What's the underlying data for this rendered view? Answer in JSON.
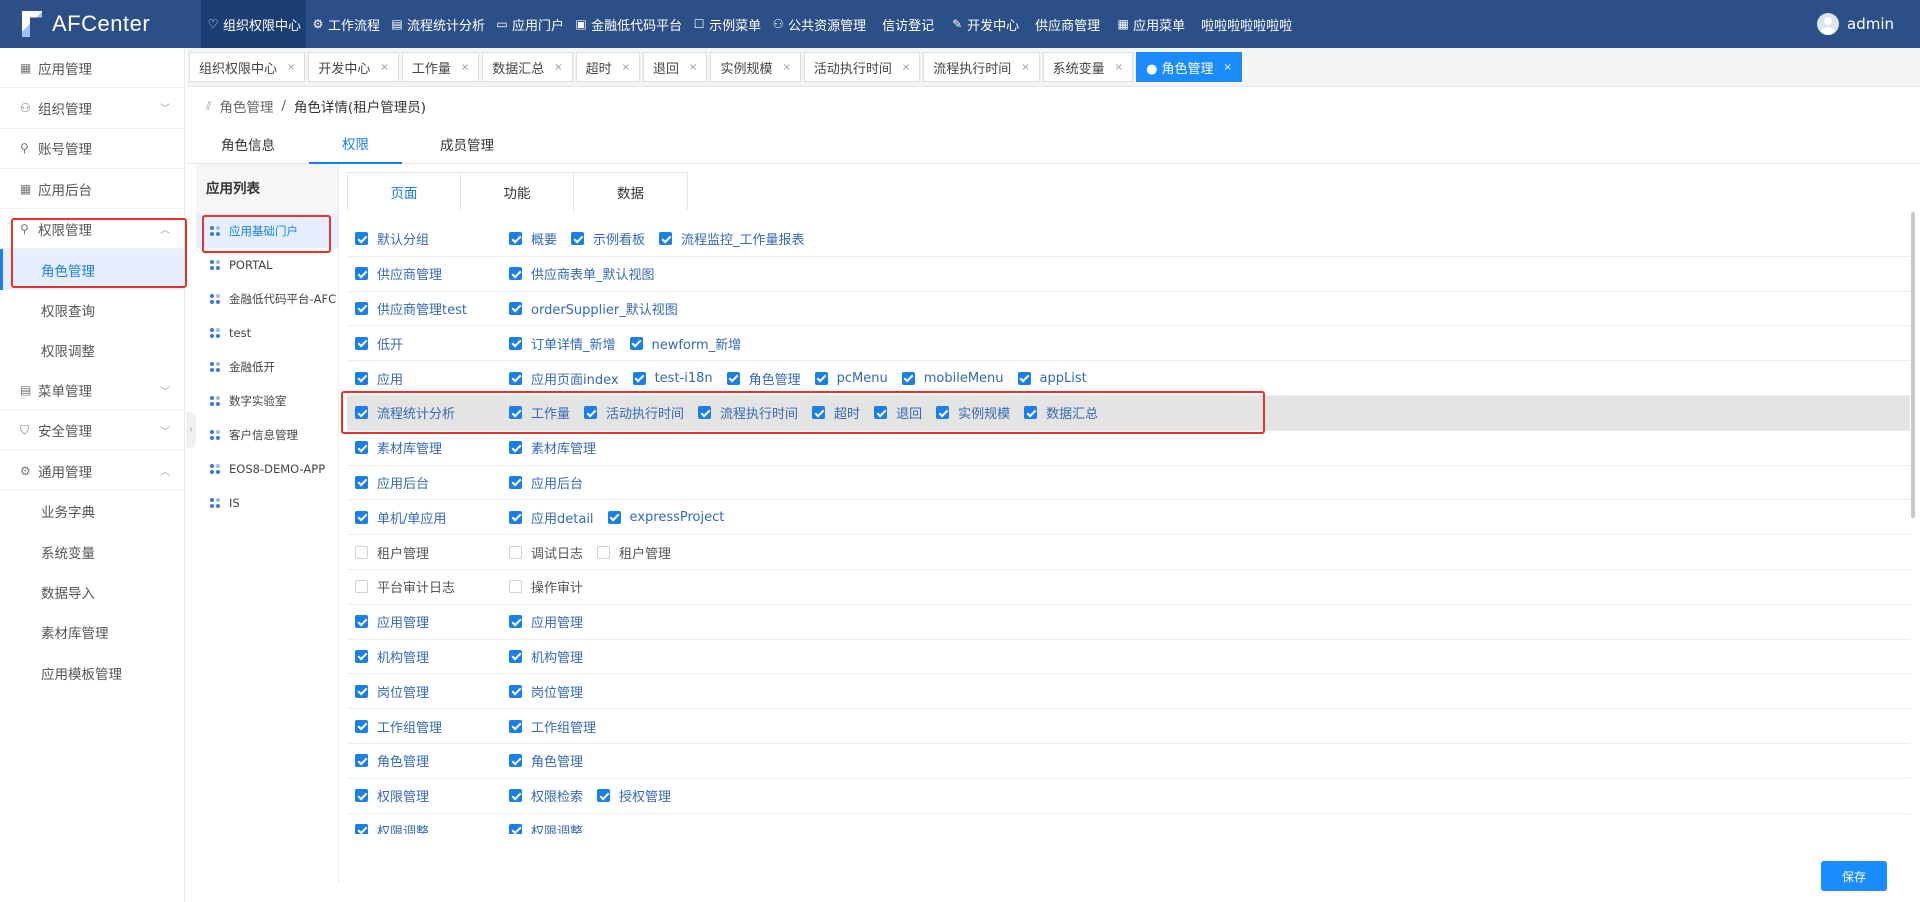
{
  "app": {
    "name": "AFCenter",
    "user": "admin"
  },
  "topnav": [
    {
      "label": "组织权限中心",
      "icon": "shield-icon",
      "glyph": "♡",
      "active": true
    },
    {
      "label": "工作流程",
      "icon": "flow-icon",
      "glyph": "⚙"
    },
    {
      "label": "流程统计分析",
      "icon": "chart-icon",
      "glyph": "▤"
    },
    {
      "label": "应用门户",
      "icon": "portal-icon",
      "glyph": "▭"
    },
    {
      "label": "金融低代码平台",
      "icon": "code-icon",
      "glyph": "▣"
    },
    {
      "label": "示例菜单",
      "icon": "menu-icon",
      "glyph": "☐"
    },
    {
      "label": "公共资源管理",
      "icon": "resource-icon",
      "glyph": "⚇"
    },
    {
      "label": "信访登记",
      "icon": "",
      "glyph": ""
    },
    {
      "label": "开发中心",
      "icon": "edit-icon",
      "glyph": "✎"
    },
    {
      "label": "供应商管理",
      "icon": "",
      "glyph": ""
    },
    {
      "label": "应用菜单",
      "icon": "apps-icon",
      "glyph": "▦"
    },
    {
      "label": "啦啦啦啦啦啦啦",
      "icon": "",
      "glyph": ""
    }
  ],
  "sidebar": [
    {
      "label": "应用管理",
      "icon": "apps-icon",
      "glyph": "▦"
    },
    {
      "label": "组织管理",
      "icon": "org-icon",
      "glyph": "⚇",
      "arrow": "﹀"
    },
    {
      "label": "账号管理",
      "icon": "user-icon",
      "glyph": "⚲"
    },
    {
      "label": "应用后台",
      "icon": "grid-icon",
      "glyph": "▦"
    },
    {
      "label": "权限管理",
      "icon": "permission-icon",
      "glyph": "⚲",
      "arrow": "︿"
    },
    {
      "label": "角色管理",
      "sub": true,
      "selected": true
    },
    {
      "label": "权限查询",
      "sub": true
    },
    {
      "label": "权限调整",
      "sub": true
    },
    {
      "label": "菜单管理",
      "icon": "menu-icon",
      "glyph": "▤",
      "arrow": "﹀"
    },
    {
      "label": "安全管理",
      "icon": "shield-icon",
      "glyph": "⛉",
      "arrow": "﹀"
    },
    {
      "label": "通用管理",
      "icon": "settings-icon",
      "glyph": "⚙",
      "arrow": "︿"
    },
    {
      "label": "业务字典",
      "sub": true
    },
    {
      "label": "系统变量",
      "sub": true
    },
    {
      "label": "数据导入",
      "sub": true
    },
    {
      "label": "素材库管理",
      "sub": true
    },
    {
      "label": "应用模板管理",
      "sub": true
    }
  ],
  "tabs": [
    "组织权限中心",
    "开发中心",
    "工作量",
    "数据汇总",
    "超时",
    "退回",
    "实例规模",
    "活动执行时间",
    "流程执行时间",
    "系统变量",
    "● 角色管理"
  ],
  "breadcrumb": {
    "parent": "角色管理",
    "separator": "/",
    "current": "角色详情(租户管理员)"
  },
  "subtabs": [
    "角色信息",
    "权限",
    "成员管理"
  ],
  "applist": {
    "title": "应用列表",
    "items": [
      "应用基础门户",
      "PORTAL",
      "金融低代码平台-AFC",
      "test",
      "金融低开",
      "数字实验室",
      "客户信息管理",
      "EOS8-DEMO-APP",
      "IS"
    ]
  },
  "permtabs": [
    "页面",
    "功能",
    "数据"
  ],
  "rows": [
    {
      "group": "默认分组",
      "checked": true,
      "items": [
        [
          "概要",
          true
        ],
        [
          "示例看板",
          true
        ],
        [
          "流程监控_工作量报表",
          true
        ]
      ]
    },
    {
      "group": "供应商管理",
      "checked": true,
      "items": [
        [
          "供应商表单_默认视图",
          true
        ]
      ]
    },
    {
      "group": "供应商管理test",
      "checked": true,
      "items": [
        [
          "orderSupplier_默认视图",
          true
        ]
      ]
    },
    {
      "group": "低开",
      "checked": true,
      "items": [
        [
          "订单详情_新增",
          true
        ],
        [
          "newform_新增",
          true
        ]
      ]
    },
    {
      "group": "应用",
      "checked": true,
      "items": [
        [
          "应用页面index",
          true
        ],
        [
          "test-i18n",
          true
        ],
        [
          "角色管理",
          true
        ],
        [
          "pcMenu",
          true
        ],
        [
          "mobileMenu",
          true
        ],
        [
          "appList",
          true
        ]
      ]
    },
    {
      "group": "流程统计分析",
      "checked": true,
      "items": [
        [
          "工作量",
          true
        ],
        [
          "活动执行时间",
          true
        ],
        [
          "流程执行时间",
          true
        ],
        [
          "超时",
          true
        ],
        [
          "退回",
          true
        ],
        [
          "实例规模",
          true
        ],
        [
          "数据汇总",
          true
        ]
      ]
    },
    {
      "group": "素材库管理",
      "checked": true,
      "items": [
        [
          "素材库管理",
          true
        ]
      ]
    },
    {
      "group": "应用后台",
      "checked": true,
      "items": [
        [
          "应用后台",
          true
        ]
      ]
    },
    {
      "group": "单机/单应用",
      "checked": true,
      "items": [
        [
          "应用detail",
          true
        ],
        [
          "expressProject",
          true
        ]
      ]
    },
    {
      "group": "租户管理",
      "checked": false,
      "items": [
        [
          "调试日志",
          false
        ],
        [
          "租户管理",
          false
        ]
      ]
    },
    {
      "group": "平台审计日志",
      "checked": false,
      "items": [
        [
          "操作审计",
          false
        ]
      ]
    },
    {
      "group": "应用管理",
      "checked": true,
      "items": [
        [
          "应用管理",
          true
        ]
      ]
    },
    {
      "group": "机构管理",
      "checked": true,
      "items": [
        [
          "机构管理",
          true
        ]
      ]
    },
    {
      "group": "岗位管理",
      "checked": true,
      "items": [
        [
          "岗位管理",
          true
        ]
      ]
    },
    {
      "group": "工作组管理",
      "checked": true,
      "items": [
        [
          "工作组管理",
          true
        ]
      ]
    },
    {
      "group": "角色管理",
      "checked": true,
      "items": [
        [
          "角色管理",
          true
        ]
      ]
    },
    {
      "group": "权限管理",
      "checked": true,
      "items": [
        [
          "权限检索",
          true
        ],
        [
          "授权管理",
          true
        ]
      ]
    },
    {
      "group": "权限调整",
      "checked": true,
      "items": [
        [
          "权限调整",
          true
        ]
      ]
    }
  ],
  "save_label": "保存",
  "colors": {
    "topbar": "#2c4f88",
    "accent": "#1a8cff",
    "highlight": "#e5322b"
  }
}
